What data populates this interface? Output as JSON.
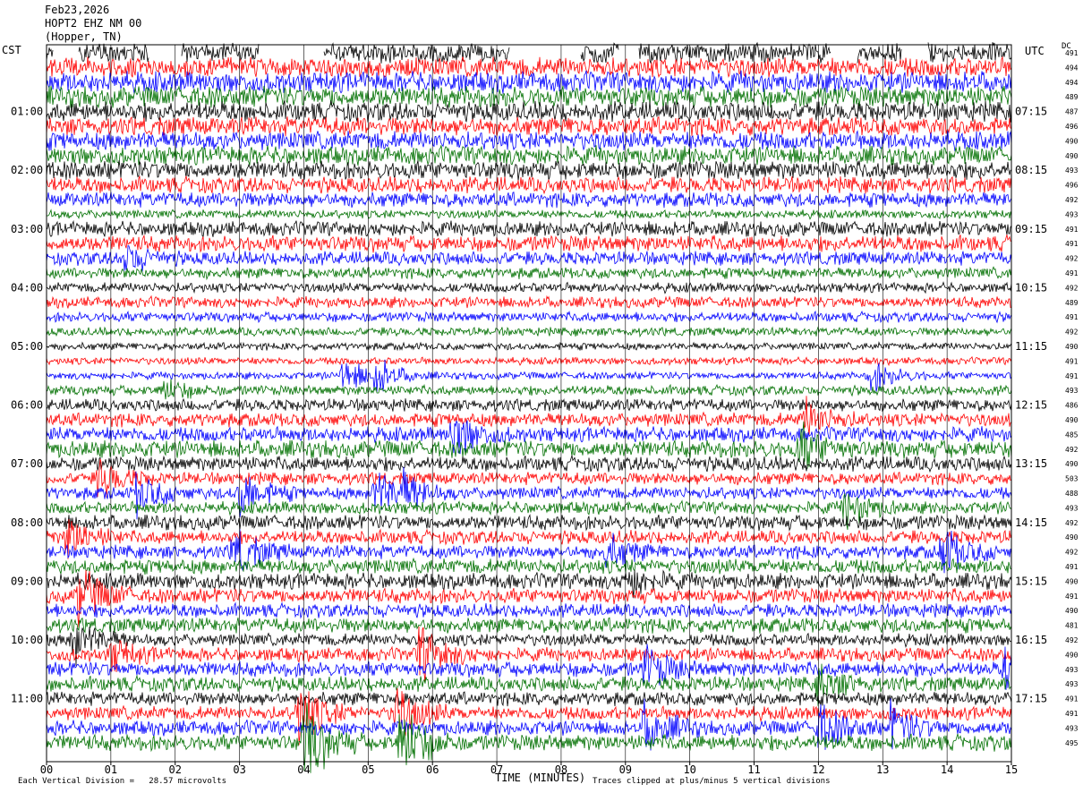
{
  "header": {
    "date": "Feb23,2026",
    "station": "HOPT2 EHZ NM 00",
    "location": "(Hopper, TN)"
  },
  "axes": {
    "left_tz": "CST",
    "right_tz": "UTC",
    "dc_label": "DC",
    "x_title": "TIME (MINUTES)"
  },
  "footer": {
    "scale_text": "Each Vertical Division =   28.57 microvolts",
    "clip_text": "Traces clipped at plus/minus 5 vertical divisions"
  },
  "colors": {
    "trace_cycle": [
      "#000000",
      "#ff0000",
      "#0000ff",
      "#007000"
    ],
    "grid": "#000000",
    "background": "#ffffff"
  },
  "chart_data": {
    "type": "line",
    "title": "HOPT2 EHZ NM 00",
    "xlabel": "TIME (MINUTES)",
    "xlim": [
      0,
      15
    ],
    "x_ticks": [
      "00",
      "01",
      "02",
      "03",
      "04",
      "05",
      "06",
      "07",
      "08",
      "09",
      "10",
      "11",
      "12",
      "13",
      "14",
      "15"
    ],
    "rows_per_hour": 4,
    "row_count": 48,
    "left_hour_labels": [
      "01:00",
      "02:00",
      "03:00",
      "04:00",
      "05:00",
      "06:00",
      "07:00",
      "08:00",
      "09:00",
      "10:00",
      "11:00"
    ],
    "right_hour_labels": [
      "07:15",
      "08:15",
      "09:15",
      "10:15",
      "11:15",
      "12:15",
      "13:15",
      "14:15",
      "15:15",
      "16:15",
      "17:15"
    ],
    "dc_offsets": [
      491,
      494,
      494,
      489,
      487,
      496,
      490,
      490,
      493,
      496,
      492,
      493,
      491,
      491,
      492,
      491,
      492,
      489,
      491,
      492,
      490,
      491,
      491,
      493,
      486,
      490,
      485,
      492,
      490,
      503,
      488,
      493,
      492,
      490,
      492,
      491,
      490,
      491,
      490,
      481,
      492,
      490,
      493,
      493,
      491,
      491,
      493,
      495
    ],
    "row_amplitude": [
      1.6,
      1.6,
      1.7,
      1.7,
      1.6,
      1.5,
      1.5,
      1.5,
      1.5,
      1.3,
      1.2,
      0.7,
      1.2,
      1.3,
      1.1,
      0.9,
      0.8,
      0.9,
      0.8,
      0.7,
      0.6,
      0.6,
      0.6,
      0.8,
      1.0,
      1.1,
      1.2,
      1.4,
      1.2,
      1.0,
      1.0,
      1.0,
      1.2,
      1.1,
      1.1,
      1.2,
      1.3,
      1.2,
      1.1,
      1.2,
      1.0,
      1.1,
      1.2,
      1.2,
      1.1,
      1.1,
      1.2,
      1.3
    ],
    "events": [
      {
        "row": 14,
        "minute": 1.2,
        "size": 1.8
      },
      {
        "row": 22,
        "minute": 4.6,
        "size": 2.2
      },
      {
        "row": 22,
        "minute": 5.1,
        "size": 2.0
      },
      {
        "row": 22,
        "minute": 12.8,
        "size": 2.0
      },
      {
        "row": 23,
        "minute": 1.8,
        "size": 1.5
      },
      {
        "row": 25,
        "minute": 11.8,
        "size": 2.2
      },
      {
        "row": 26,
        "minute": 6.3,
        "size": 3.0
      },
      {
        "row": 27,
        "minute": 11.7,
        "size": 2.6
      },
      {
        "row": 29,
        "minute": 0.8,
        "size": 2.4
      },
      {
        "row": 30,
        "minute": 1.4,
        "size": 2.5
      },
      {
        "row": 30,
        "minute": 3.0,
        "size": 3.0
      },
      {
        "row": 30,
        "minute": 5.1,
        "size": 3.0
      },
      {
        "row": 30,
        "minute": 5.5,
        "size": 2.0
      },
      {
        "row": 31,
        "minute": 12.4,
        "size": 2.6
      },
      {
        "row": 33,
        "minute": 0.3,
        "size": 2.5
      },
      {
        "row": 34,
        "minute": 2.9,
        "size": 3.0
      },
      {
        "row": 34,
        "minute": 8.7,
        "size": 2.0
      },
      {
        "row": 34,
        "minute": 13.9,
        "size": 3.0
      },
      {
        "row": 36,
        "minute": 9.0,
        "size": 1.8
      },
      {
        "row": 37,
        "minute": 0.5,
        "size": 3.5
      },
      {
        "row": 40,
        "minute": 0.4,
        "size": 3.0
      },
      {
        "row": 41,
        "minute": 5.8,
        "size": 3.5
      },
      {
        "row": 41,
        "minute": 1.0,
        "size": 1.8
      },
      {
        "row": 42,
        "minute": 9.3,
        "size": 2.6
      },
      {
        "row": 42,
        "minute": 14.9,
        "size": 2.5
      },
      {
        "row": 43,
        "minute": 12.0,
        "size": 2.2
      },
      {
        "row": 45,
        "minute": 3.9,
        "size": 4.0
      },
      {
        "row": 45,
        "minute": 5.4,
        "size": 4.0
      },
      {
        "row": 46,
        "minute": 9.3,
        "size": 3.0
      },
      {
        "row": 46,
        "minute": 12.0,
        "size": 3.0
      },
      {
        "row": 46,
        "minute": 13.1,
        "size": 2.6
      },
      {
        "row": 47,
        "minute": 4.0,
        "size": 5.0
      },
      {
        "row": 47,
        "minute": 5.5,
        "size": 5.0
      }
    ],
    "first_row_gaps": [
      [
        0.1,
        0.5
      ],
      [
        1.6,
        2.1
      ],
      [
        3.3,
        4.3
      ],
      [
        7.2,
        8.3
      ],
      [
        8.9,
        9.2
      ],
      [
        12.2,
        12.6
      ],
      [
        13.3,
        13.7
      ]
    ]
  }
}
